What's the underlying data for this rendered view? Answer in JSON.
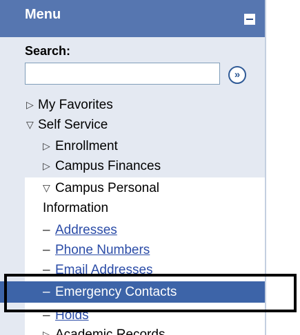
{
  "menu": {
    "title": "Menu",
    "search_label": "Search:",
    "search_value": "",
    "go_glyph": "»",
    "collapse_icon": "minus-icon"
  },
  "nav": {
    "my_favorites": "My Favorites",
    "self_service": "Self Service",
    "enrollment": "Enrollment",
    "campus_finances": "Campus Finances",
    "campus_personal_line1": "Campus Personal",
    "campus_personal_line2": "Information",
    "addresses": "Addresses",
    "phone_numbers": "Phone Numbers",
    "email_addresses": "Email Addresses",
    "emergency_contacts": "Emergency Contacts",
    "holds": "Holds",
    "academic_records": "Academic Records"
  },
  "glyphs": {
    "collapsed": "▷",
    "expanded": "▽",
    "dash": "–"
  },
  "colors": {
    "header": "#5676b0",
    "panel": "#e4e9f2",
    "selected": "#3d64a8",
    "link": "#2b4ca7"
  }
}
